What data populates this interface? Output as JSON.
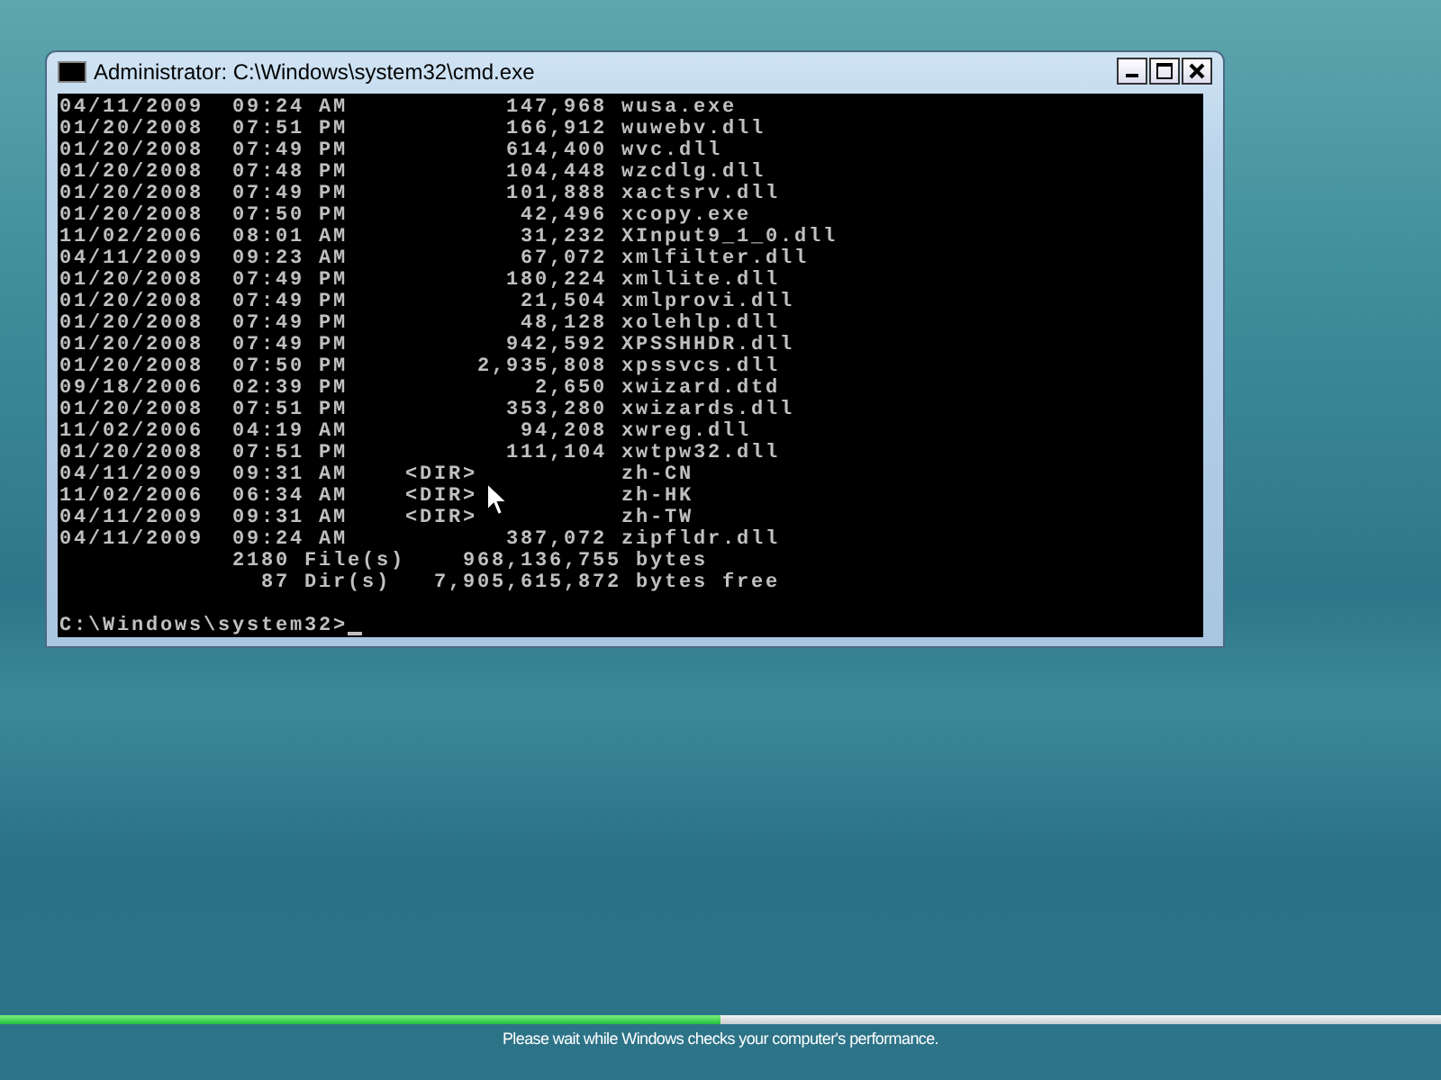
{
  "window": {
    "title": "Administrator: C:\\Windows\\system32\\cmd.exe"
  },
  "console": {
    "entries": [
      {
        "kind": "file",
        "date": "04/11/2009",
        "time": "09:24 AM",
        "size": "147,968",
        "name": "wusa.exe"
      },
      {
        "kind": "file",
        "date": "01/20/2008",
        "time": "07:51 PM",
        "size": "166,912",
        "name": "wuwebv.dll"
      },
      {
        "kind": "file",
        "date": "01/20/2008",
        "time": "07:49 PM",
        "size": "614,400",
        "name": "wvc.dll"
      },
      {
        "kind": "file",
        "date": "01/20/2008",
        "time": "07:48 PM",
        "size": "104,448",
        "name": "wzcdlg.dll"
      },
      {
        "kind": "file",
        "date": "01/20/2008",
        "time": "07:49 PM",
        "size": "101,888",
        "name": "xactsrv.dll"
      },
      {
        "kind": "file",
        "date": "01/20/2008",
        "time": "07:50 PM",
        "size": "42,496",
        "name": "xcopy.exe"
      },
      {
        "kind": "file",
        "date": "11/02/2006",
        "time": "08:01 AM",
        "size": "31,232",
        "name": "XInput9_1_0.dll"
      },
      {
        "kind": "file",
        "date": "04/11/2009",
        "time": "09:23 AM",
        "size": "67,072",
        "name": "xmlfilter.dll"
      },
      {
        "kind": "file",
        "date": "01/20/2008",
        "time": "07:49 PM",
        "size": "180,224",
        "name": "xmllite.dll"
      },
      {
        "kind": "file",
        "date": "01/20/2008",
        "time": "07:49 PM",
        "size": "21,504",
        "name": "xmlprovi.dll"
      },
      {
        "kind": "file",
        "date": "01/20/2008",
        "time": "07:49 PM",
        "size": "48,128",
        "name": "xolehlp.dll"
      },
      {
        "kind": "file",
        "date": "01/20/2008",
        "time": "07:49 PM",
        "size": "942,592",
        "name": "XPSSHHDR.dll"
      },
      {
        "kind": "file",
        "date": "01/20/2008",
        "time": "07:50 PM",
        "size": "2,935,808",
        "name": "xpssvcs.dll"
      },
      {
        "kind": "file",
        "date": "09/18/2006",
        "time": "02:39 PM",
        "size": "2,650",
        "name": "xwizard.dtd"
      },
      {
        "kind": "file",
        "date": "01/20/2008",
        "time": "07:51 PM",
        "size": "353,280",
        "name": "xwizards.dll"
      },
      {
        "kind": "file",
        "date": "11/02/2006",
        "time": "04:19 AM",
        "size": "94,208",
        "name": "xwreg.dll"
      },
      {
        "kind": "file",
        "date": "01/20/2008",
        "time": "07:51 PM",
        "size": "111,104",
        "name": "xwtpw32.dll"
      },
      {
        "kind": "dir",
        "date": "04/11/2009",
        "time": "09:31 AM",
        "size": "<DIR>",
        "name": "zh-CN"
      },
      {
        "kind": "dir",
        "date": "11/02/2006",
        "time": "06:34 AM",
        "size": "<DIR>",
        "name": "zh-HK"
      },
      {
        "kind": "dir",
        "date": "04/11/2009",
        "time": "09:31 AM",
        "size": "<DIR>",
        "name": "zh-TW"
      },
      {
        "kind": "file",
        "date": "04/11/2009",
        "time": "09:24 AM",
        "size": "387,072",
        "name": "zipfldr.dll"
      }
    ],
    "summary": [
      {
        "count": "2180",
        "label": "File(s)",
        "bytes": "968,136,755",
        "unit": "bytes"
      },
      {
        "count": "87",
        "label": "Dir(s)",
        "bytes": "7,905,615,872",
        "unit": "bytes free"
      }
    ],
    "prompt": "C:\\Windows\\system32>"
  },
  "progress": {
    "level": 0.5,
    "message": "Please wait while Windows checks your computer's performance."
  }
}
